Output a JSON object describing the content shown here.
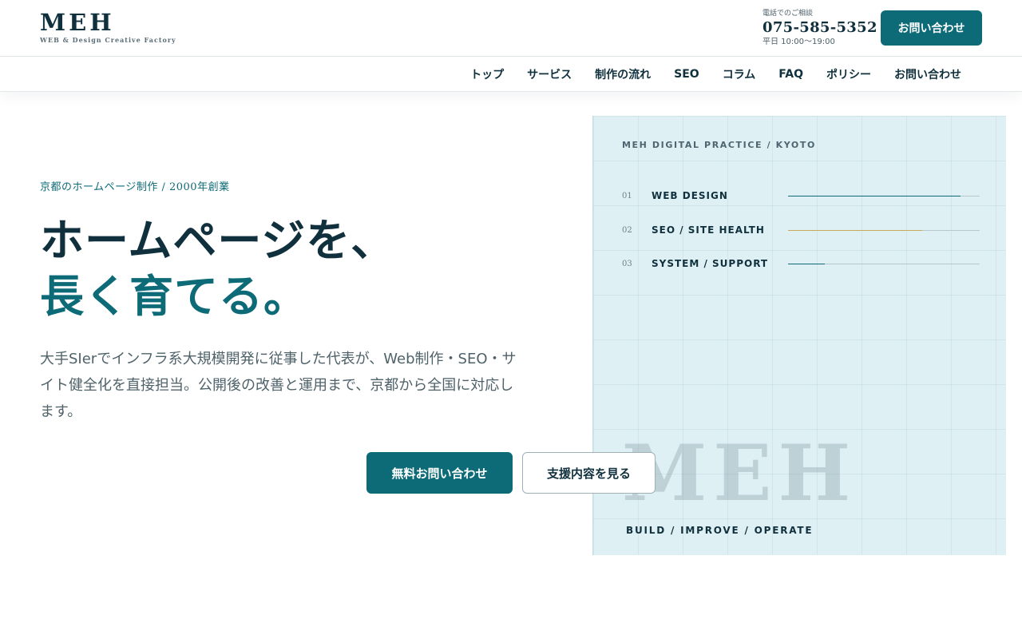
{
  "header": {
    "logo": "MEH",
    "tagline": "WEB & Design Creative Factory",
    "phone_label": "電話でのご相談",
    "phone_number": "075-585-5352",
    "phone_hours": "平日 10:00〜19:00",
    "cta_label": "お問い合わせ"
  },
  "nav": {
    "items": [
      "トップ",
      "サービス",
      "制作の流れ",
      "SEO",
      "コラム",
      "FAQ",
      "ポリシー",
      "お問い合わせ"
    ]
  },
  "hero": {
    "kicker": "京都のホームページ制作 / 2000年創業",
    "headline_line1": "ホームページを、",
    "headline_line2": "長く育てる。",
    "lead": "大手SIerでインフラ系大規模開発に従事した代表が、Web制作・SEO・サイト健全化を直接担当。公開後の改善と運用まで、京都から全国に対応します。",
    "primary_button": "無料お問い合わせ",
    "secondary_button": "支援内容を見る"
  },
  "panel": {
    "label": "MEH DIGITAL PRACTICE / KYOTO",
    "services": [
      {
        "number": "01",
        "name": "WEB DESIGN",
        "level": 0.9,
        "color": "#0d6b78"
      },
      {
        "number": "02",
        "name": "SEO / SITE HEALTH",
        "level": 0.7,
        "color": "#c9a95a"
      },
      {
        "number": "03",
        "name": "SYSTEM / SUPPORT",
        "level": 0.19,
        "color": "#0d6b78"
      }
    ],
    "watermark": "MEH",
    "footer": "BUILD / IMPROVE / OPERATE"
  },
  "colors": {
    "accent": "#0d6b78",
    "ink": "#10303d",
    "panel_bg": "#dff0f4"
  }
}
